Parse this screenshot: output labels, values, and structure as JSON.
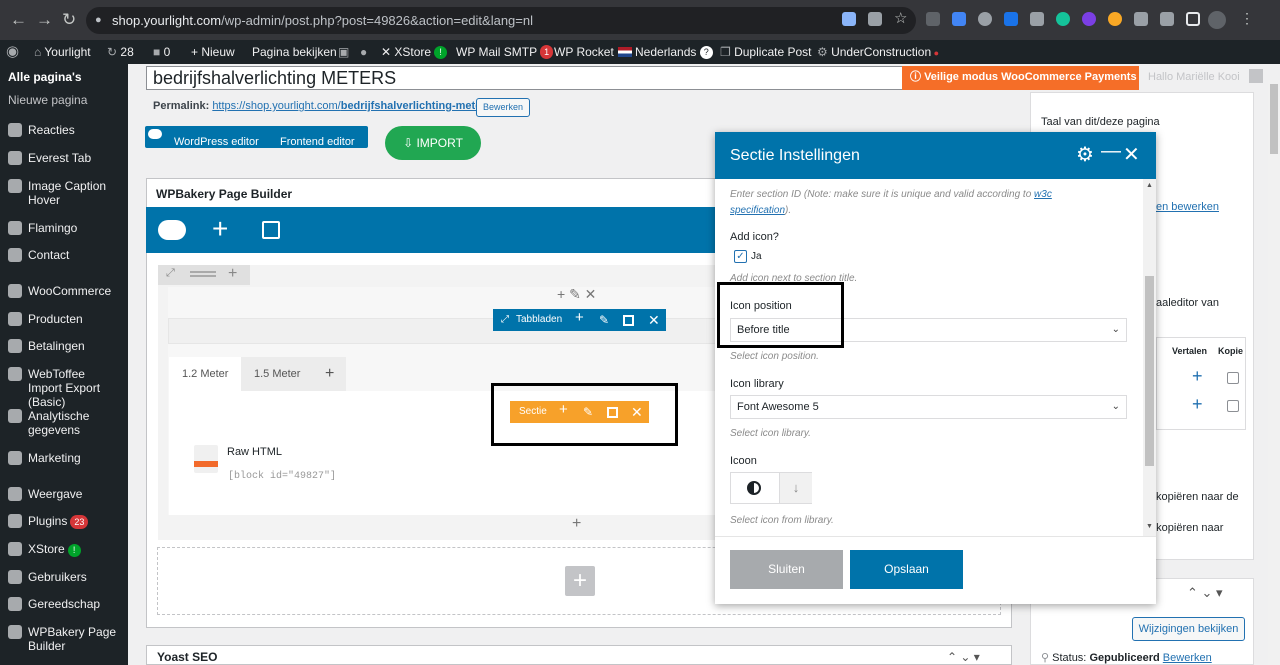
{
  "browser": {
    "url_host": "shop.yourlight.com",
    "url_path": "/wp-admin/post.php?post=49826&action=edit&lang=nl"
  },
  "adminbar": {
    "site": "Yourlight",
    "updates": "28",
    "comments": "0",
    "new": "Nieuw",
    "view_page": "Pagina bekijken",
    "xstore": "XStore",
    "wp_mail": "WP Mail SMTP",
    "wp_mail_badge": "1",
    "wp_rocket": "WP Rocket",
    "language": "Nederlands",
    "duplicate": "Duplicate Post",
    "under_construction": "UnderConstruction"
  },
  "sidebar": {
    "current": "Alle pagina's",
    "sub_new": "Nieuwe pagina",
    "items": [
      {
        "label": "Reacties"
      },
      {
        "label": "Everest Tab"
      },
      {
        "label": "Image Caption Hover"
      },
      {
        "label": "Flamingo"
      },
      {
        "label": "Contact"
      },
      {
        "label": "WooCommerce"
      },
      {
        "label": "Producten"
      },
      {
        "label": "Betalingen"
      },
      {
        "label": "WebToffee Import Export (Basic)"
      },
      {
        "label": "Analytische gegevens"
      },
      {
        "label": "Marketing"
      },
      {
        "label": "Weergave"
      },
      {
        "label": "Plugins",
        "badge": "23"
      },
      {
        "label": "XStore"
      },
      {
        "label": "Gebruikers"
      },
      {
        "label": "Gereedschap"
      },
      {
        "label": "WPBakery Page Builder"
      }
    ]
  },
  "editor": {
    "title_value": "bedrijfshalverlichting METERS",
    "permalink_label": "Permalink:",
    "permalink_url_prefix": "https://shop.yourlight.com/",
    "permalink_slug": "bedrijfshalverlichting-meters",
    "permalink_suffix": "/",
    "permalink_edit": "Bewerken",
    "btn_wp_editor": "WordPress editor",
    "btn_frontend_editor": "Frontend editor",
    "btn_import": "IMPORT",
    "wpb_title": "WPBakery Page Builder",
    "tabs_element_label": "Tabbladen",
    "tab1": "1.2 Meter",
    "tab2": "1.5 Meter",
    "section_element_label": "Sectie",
    "raw_html_title": "Raw HTML",
    "raw_html_code": "[block id=\"49827\"]",
    "yoast": "Yoast SEO"
  },
  "right": {
    "woo_notice": "Veilige modus WooCommerce Payments",
    "howdy": "Hallo Mariëlle Kooi",
    "taal": "Taal van dit/deze pagina",
    "en_bewerken": "en bewerken",
    "aaleditor": "aaleditor van",
    "col_vertalen": "Vertalen",
    "col_kopie": "Kopie",
    "kopieren1": "kopiëren naar de",
    "kopieren2": "kopiëren naar",
    "wijzigingen": "Wijzigingen bekijken",
    "status_label": "Status:",
    "status_value": "Gepubliceerd",
    "status_edit": "Bewerken"
  },
  "modal": {
    "title": "Sectie Instellingen",
    "section_id_hint_pre": "Enter section ID (Note: make sure it is unique and valid according to ",
    "section_id_hint_link1": "w3c",
    "section_id_hint_link2": "specification",
    "section_id_hint_post": ").",
    "add_icon_label": "Add icon?",
    "add_icon_option": "Ja",
    "add_icon_hint": "Add icon next to section title.",
    "icon_position_label": "Icon position",
    "icon_position_value": "Before title",
    "icon_position_hint": "Select icon position.",
    "icon_library_label": "Icon library",
    "icon_library_value": "Font Awesome 5",
    "icon_library_hint": "Select icon library.",
    "icon_label": "Icoon",
    "icon_hint": "Select icon from library.",
    "btn_close": "Sluiten",
    "btn_save": "Opslaan"
  }
}
